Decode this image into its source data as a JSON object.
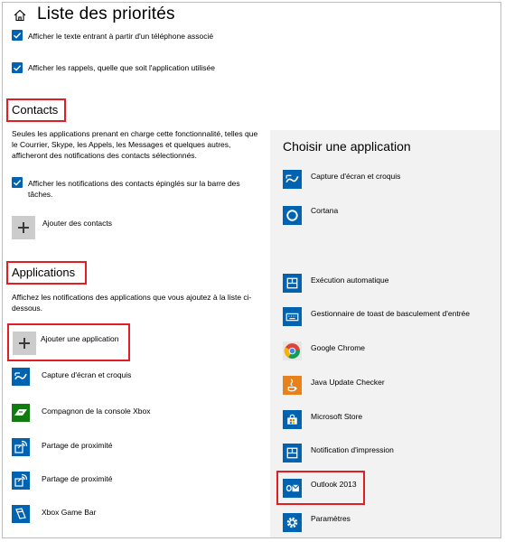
{
  "header": {
    "title": "Liste des priorités"
  },
  "options": {
    "text_phone": "Afficher le texte entrant à partir d'un téléphone associé",
    "reminders": "Afficher les rappels, quelle que soit l'application utilisée"
  },
  "contacts": {
    "heading": "Contacts",
    "description_line1": "Seules les applications prenant en charge cette fonctionnalité, telles que",
    "description_line2": "le Courrier, Skype, les Appels, les Messages et quelques autres,",
    "description_line3": "afficheront des notifications des contacts sélectionnés.",
    "pinned_line1": "Afficher les notifications des contacts épinglés sur la barre des",
    "pinned_line2": "tâches.",
    "add_label": "Ajouter des contacts"
  },
  "applications": {
    "heading": "Applications",
    "description_line1": "Affichez les notifications des applications que vous ajoutez à la liste ci-",
    "description_line2": "dessous.",
    "add_label": "Ajouter une application",
    "items": [
      {
        "label": "Capture d'écran et croquis",
        "icon": "snip-sketch-icon",
        "color": "#0063b1"
      },
      {
        "label": "Compagnon de la console Xbox",
        "icon": "xbox-console-icon",
        "color": "#107c10"
      },
      {
        "label": "Partage de proximité",
        "icon": "proximity-sharing-icon",
        "color": "#0063b1"
      },
      {
        "label": "Partage de proximité",
        "icon": "proximity-sharing-icon",
        "color": "#0063b1"
      },
      {
        "label": "Xbox Game Bar",
        "icon": "game-bar-icon",
        "color": "#0063b1"
      }
    ]
  },
  "chooser": {
    "title": "Choisir une application",
    "items": [
      {
        "label": "Capture d'écran et croquis",
        "icon": "snip-sketch-icon"
      },
      {
        "label": "Cortana",
        "icon": "cortana-icon"
      },
      {
        "label": "Exécution automatique",
        "icon": "autoplay-icon"
      },
      {
        "label": "Gestionnaire de toast de basculement d'entrée",
        "icon": "input-switch-icon"
      },
      {
        "label": "Google Chrome",
        "icon": "chrome-icon"
      },
      {
        "label": "Java Update Checker",
        "icon": "java-icon"
      },
      {
        "label": "Microsoft Store",
        "icon": "store-icon"
      },
      {
        "label": "Notification d'impression",
        "icon": "print-notification-icon"
      },
      {
        "label": "Outlook 2013",
        "icon": "outlook-icon"
      },
      {
        "label": "Paramètres",
        "icon": "settings-gear-icon"
      }
    ]
  },
  "colors": {
    "accent": "#0063b1",
    "highlight": "#e01e23",
    "panel_bg": "#f2f2f2"
  }
}
